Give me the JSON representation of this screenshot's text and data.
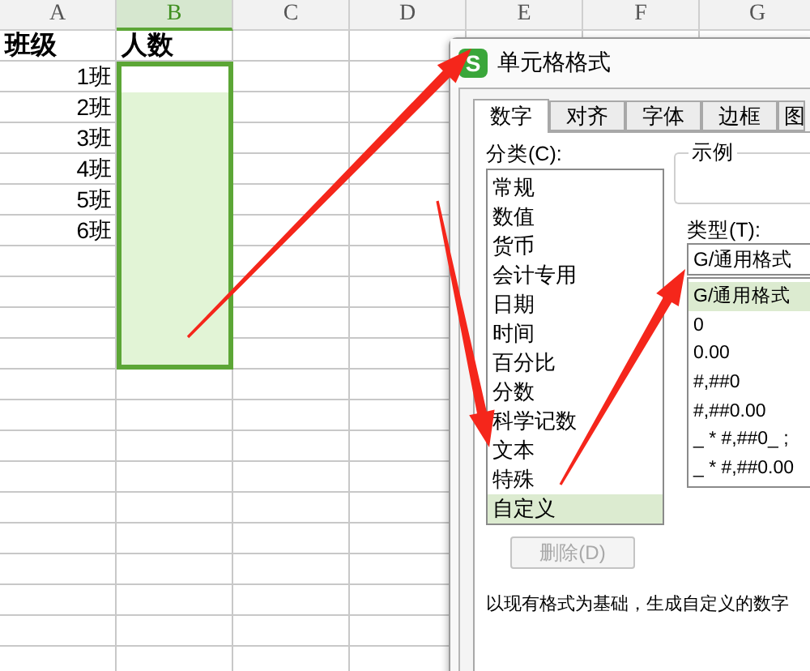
{
  "sheet": {
    "columns": [
      {
        "label": "A",
        "selected": false
      },
      {
        "label": "B",
        "selected": true
      },
      {
        "label": "C",
        "selected": false
      },
      {
        "label": "D",
        "selected": false
      },
      {
        "label": "E",
        "selected": false
      },
      {
        "label": "F",
        "selected": false
      },
      {
        "label": "G",
        "selected": false
      }
    ],
    "rows": [
      {
        "kind": "header",
        "cells": [
          "班级",
          "人数"
        ],
        "selected": false,
        "active": false
      },
      {
        "kind": "data",
        "cells": [
          "1班"
        ],
        "selected": true,
        "active": true
      },
      {
        "kind": "data",
        "cells": [
          "2班"
        ],
        "selected": true
      },
      {
        "kind": "data",
        "cells": [
          "3班"
        ],
        "selected": true
      },
      {
        "kind": "data",
        "cells": [
          "4班"
        ],
        "selected": true
      },
      {
        "kind": "data",
        "cells": [
          "5班"
        ],
        "selected": true
      },
      {
        "kind": "data",
        "cells": [
          "6班"
        ],
        "selected": true
      },
      {
        "kind": "data",
        "selected": true
      },
      {
        "kind": "data",
        "selected": true
      },
      {
        "kind": "data",
        "selected": true
      },
      {
        "kind": "data",
        "selected": true
      }
    ]
  },
  "dialog": {
    "app_icon_letter": "S",
    "title": "单元格格式",
    "tabs": [
      {
        "label": "数字",
        "selected": true
      },
      {
        "label": "对齐",
        "selected": false
      },
      {
        "label": "字体",
        "selected": false
      },
      {
        "label": "边框",
        "selected": false
      },
      {
        "label": "图",
        "selected": false
      }
    ],
    "category_label": "分类(C):",
    "categories": [
      {
        "label": "常规",
        "selected": false
      },
      {
        "label": "数值",
        "selected": false
      },
      {
        "label": "货币",
        "selected": false
      },
      {
        "label": "会计专用",
        "selected": false
      },
      {
        "label": "日期",
        "selected": false
      },
      {
        "label": "时间",
        "selected": false
      },
      {
        "label": "百分比",
        "selected": false
      },
      {
        "label": "分数",
        "selected": false
      },
      {
        "label": "科学记数",
        "selected": false
      },
      {
        "label": "文本",
        "selected": false
      },
      {
        "label": "特殊",
        "selected": false
      },
      {
        "label": "自定义",
        "selected": true
      }
    ],
    "delete_button": {
      "label": "删除(D)",
      "disabled": true
    },
    "sample_label": "示例",
    "type_label": "类型(T):",
    "type_value": "G/通用格式",
    "types": [
      {
        "label": "G/通用格式",
        "selected": true
      },
      {
        "label": "0",
        "selected": false
      },
      {
        "label": "0.00",
        "selected": false
      },
      {
        "label": "#,##0",
        "selected": false
      },
      {
        "label": "#,##0.00",
        "selected": false
      },
      {
        "label": "_ * #,##0_ ;",
        "selected": false
      },
      {
        "label": "_ * #,##0.00",
        "selected": false
      }
    ],
    "description": "以现有格式为基础，生成自定义的数字"
  }
}
